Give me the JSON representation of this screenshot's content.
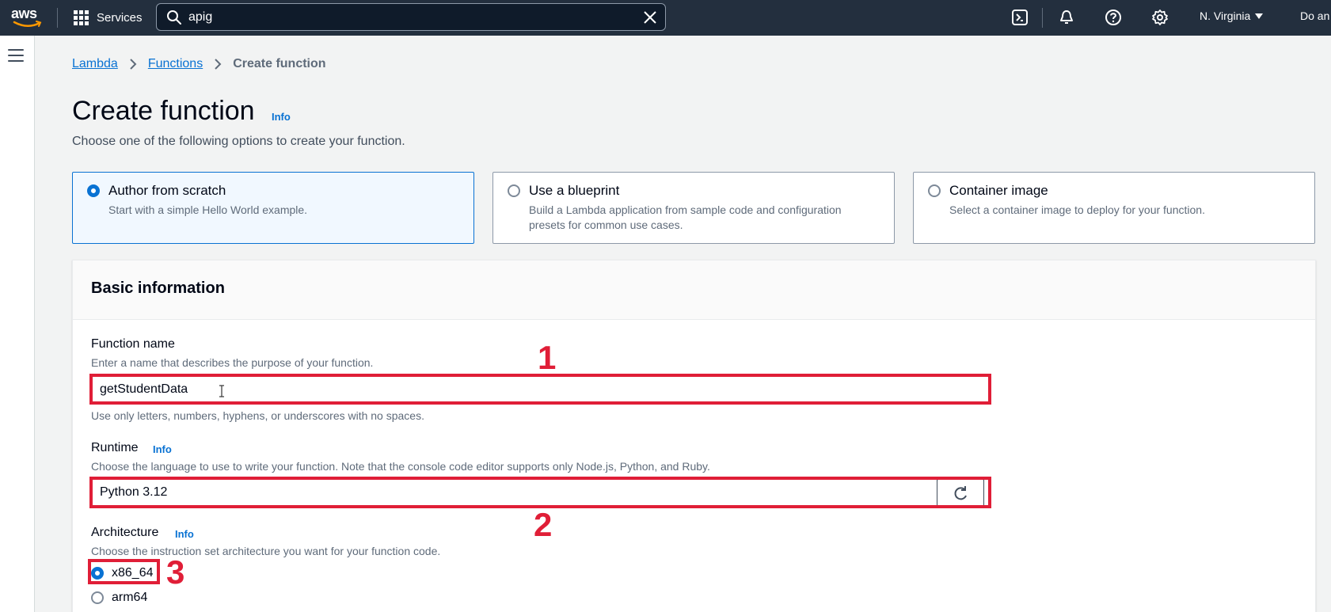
{
  "topnav": {
    "logo_text": "aws",
    "services_label": "Services",
    "search_value": "apig",
    "region_label": "N. Virginia",
    "account_label": "Do an",
    "icons": [
      "grid-icon",
      "search-icon",
      "close-icon",
      "cloudshell-icon",
      "notifications-icon",
      "help-icon",
      "settings-icon"
    ]
  },
  "breadcrumb": {
    "items": [
      "Lambda",
      "Functions"
    ],
    "current": "Create function"
  },
  "page": {
    "title": "Create function",
    "info_label": "Info",
    "description": "Choose one of the following options to create your function."
  },
  "options": [
    {
      "title": "Author from scratch",
      "description": "Start with a simple Hello World example.",
      "selected": true
    },
    {
      "title": "Use a blueprint",
      "description": "Build a Lambda application from sample code and configuration presets for common use cases.",
      "selected": false
    },
    {
      "title": "Container image",
      "description": "Select a container image to deploy for your function.",
      "selected": false
    }
  ],
  "basic_info": {
    "heading": "Basic information",
    "function_name": {
      "label": "Function name",
      "description": "Enter a name that describes the purpose of your function.",
      "value": "getStudentData",
      "constraint": "Use only letters, numbers, hyphens, or underscores with no spaces."
    },
    "runtime": {
      "label": "Runtime",
      "info_label": "Info",
      "description": "Choose the language to use to write your function. Note that the console code editor supports only Node.js, Python, and Ruby.",
      "value": "Python 3.12"
    },
    "architecture": {
      "label": "Architecture",
      "info_label": "Info",
      "description": "Choose the instruction set architecture you want for your function code.",
      "options": [
        {
          "label": "x86_64",
          "selected": true
        },
        {
          "label": "arm64",
          "selected": false
        }
      ]
    }
  },
  "annotations": [
    "1",
    "2",
    "3"
  ],
  "colors": {
    "nav_bg": "#232f3e",
    "accent": "#0972d3",
    "annotation": "#e01e37"
  }
}
